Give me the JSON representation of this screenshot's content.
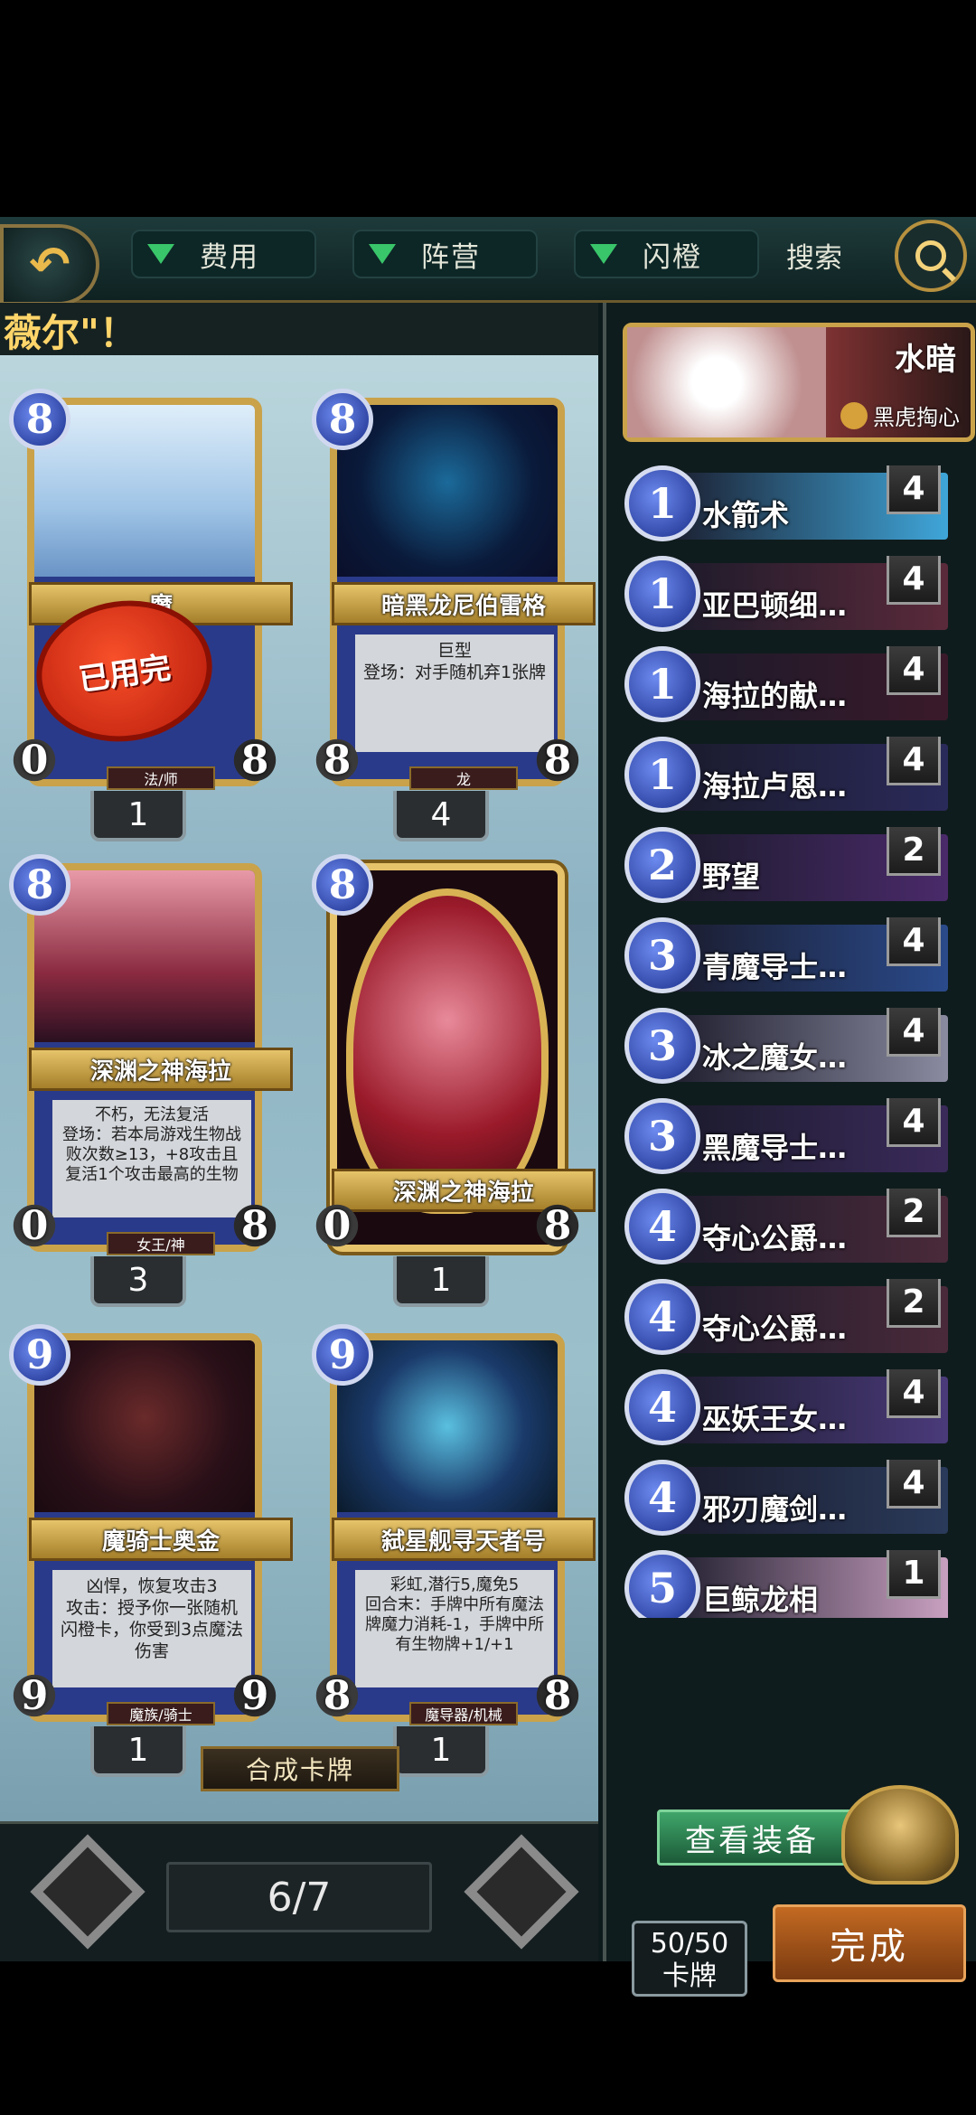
{
  "filters": {
    "cost": "费用",
    "faction": "阵营",
    "flash": "闪橙",
    "search": "搜索"
  },
  "banner": "薇尔\"！",
  "cards": [
    {
      "cost": "8",
      "name": "魔",
      "desc": "",
      "tribe": "法/师",
      "atk": "0",
      "hp": "8",
      "count": "1",
      "stamp": "已用完"
    },
    {
      "cost": "8",
      "name": "暗黑龙尼伯雷格",
      "desc": "巨型\n登场：对手随机弃1张牌",
      "tribe": "龙",
      "atk": "8",
      "hp": "8",
      "count": "4"
    },
    {
      "cost": "8",
      "name": "深渊之神海拉",
      "desc": "不朽，无法复活\n登场：若本局游戏生物战败次数≥13，+8攻击且复活1个攻击最高的生物",
      "tribe": "女王/神",
      "atk": "0",
      "hp": "8",
      "count": "3"
    },
    {
      "cost": "8",
      "name": "深渊之神海拉",
      "desc": "",
      "tribe": "",
      "atk": "0",
      "hp": "8",
      "count": "1"
    },
    {
      "cost": "9",
      "name": "魔骑士奥金",
      "desc": "凶悍，恢复攻击3\n攻击：授予你一张随机闪橙卡，你受到3点魔法伤害",
      "tribe": "魔族/骑士",
      "atk": "9",
      "hp": "9",
      "count": "1"
    },
    {
      "cost": "9",
      "name": "弑星舰寻天者号",
      "desc": "彩虹,潜行5,魔免5\n回合末：手牌中所有魔法牌魔力消耗-1，手牌中所有生物牌+1/+1",
      "tribe": "魔导器/机械",
      "atk": "8",
      "hp": "8",
      "count": "1"
    }
  ],
  "combine": "合成卡牌",
  "page": "6/7",
  "hero": {
    "name": "水暗",
    "sub": "黑虎掏心"
  },
  "deck": [
    {
      "cost": "1",
      "name": "水箭术",
      "qty": "4",
      "color": "#3fa6d9"
    },
    {
      "cost": "1",
      "name": "亚巴顿细…",
      "qty": "4",
      "color": "#5a2a3a"
    },
    {
      "cost": "1",
      "name": "海拉的献…",
      "qty": "4",
      "color": "#3a1a2a"
    },
    {
      "cost": "1",
      "name": "海拉卢恩…",
      "qty": "4",
      "color": "#2a2a5a"
    },
    {
      "cost": "2",
      "name": "野望",
      "qty": "2",
      "color": "#4a2a6a"
    },
    {
      "cost": "3",
      "name": "青魔导士…",
      "qty": "4",
      "color": "#2a4a8a"
    },
    {
      "cost": "3",
      "name": "冰之魔女…",
      "qty": "4",
      "color": "#8a8aa0"
    },
    {
      "cost": "3",
      "name": "黑魔导士…",
      "qty": "4",
      "color": "#3a2a5a"
    },
    {
      "cost": "4",
      "name": "夺心公爵…",
      "qty": "2",
      "color": "#4a2a3a"
    },
    {
      "cost": "4",
      "name": "夺心公爵…",
      "qty": "2",
      "color": "#4a2a3a"
    },
    {
      "cost": "4",
      "name": "巫妖王女…",
      "qty": "4",
      "color": "#4a3a7a"
    },
    {
      "cost": "4",
      "name": "邪刃魔剑…",
      "qty": "4",
      "color": "#2a3a5a"
    },
    {
      "cost": "5",
      "name": "巨鲸龙相",
      "qty": "1",
      "color": "#c9a0c0"
    }
  ],
  "equip": "查看装备",
  "deck_count": {
    "value": "50/50",
    "label": "卡牌"
  },
  "done": "完成"
}
